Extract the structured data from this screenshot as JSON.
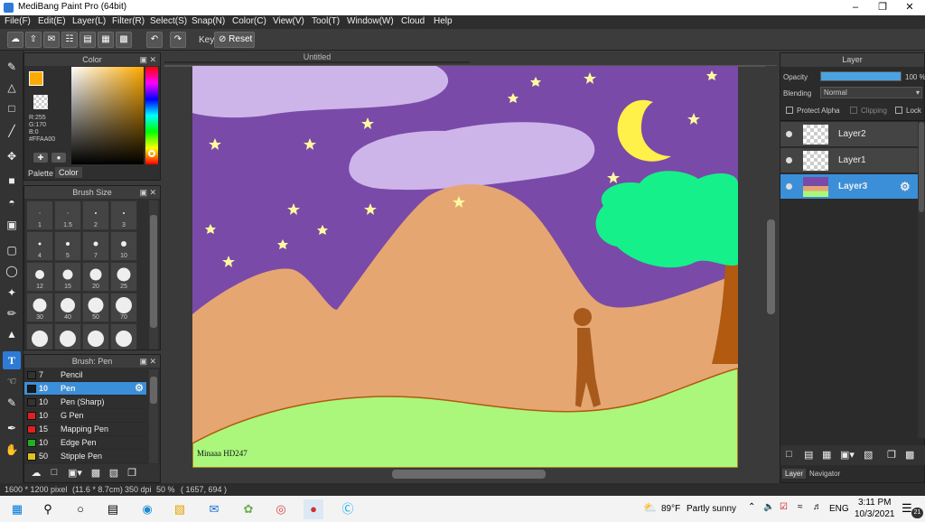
{
  "app": {
    "title": "MediBang Paint Pro (64bit)"
  },
  "menu": [
    "File(F)",
    "Edit(E)",
    "Layer(L)",
    "Filter(R)",
    "Select(S)",
    "Snap(N)",
    "Color(C)",
    "View(V)",
    "Tool(T)",
    "Window(W)",
    "Cloud",
    "Help"
  ],
  "toolbar": {
    "key_label": "Key",
    "reset_label": "Reset"
  },
  "color_panel": {
    "title": "Color",
    "r": "R:255",
    "g": "G:170",
    "b": "B:0",
    "hex": "#FFAA00",
    "tab_palette": "Palette",
    "tab_color": "Color",
    "fg": "#ffaa00"
  },
  "brush_size_panel": {
    "title": "Brush Size",
    "sizes": [
      "1",
      "1.5",
      "2",
      "3",
      "4",
      "5",
      "7",
      "10",
      "12",
      "15",
      "20",
      "25",
      "30",
      "40",
      "50",
      "70",
      "",
      "",
      "",
      ""
    ]
  },
  "brush_panel": {
    "title": "Brush: Pen",
    "brushes": [
      {
        "size": "7",
        "name": "Pencil",
        "color": "#333333"
      },
      {
        "size": "10",
        "name": "Pen",
        "color": "#1a1a1a"
      },
      {
        "size": "10",
        "name": "Pen (Sharp)",
        "color": "#333333"
      },
      {
        "size": "10",
        "name": "G Pen",
        "color": "#e02020"
      },
      {
        "size": "15",
        "name": "Mapping Pen",
        "color": "#e02020"
      },
      {
        "size": "10",
        "name": "Edge Pen",
        "color": "#20b020"
      },
      {
        "size": "50",
        "name": "Stipple Pen",
        "color": "#e0c020"
      }
    ]
  },
  "canvas": {
    "tab_title": "Untitled",
    "signature": "Minaaa HD247"
  },
  "layer_panel": {
    "title": "Layer",
    "opacity_label": "Opacity",
    "opacity_value": "100 %",
    "opacity_fraction": 1.0,
    "blending_label": "Blending",
    "blending_value": "Normal",
    "protect_alpha": "Protect Alpha",
    "clipping": "Clipping",
    "lock": "Lock",
    "layers": [
      {
        "name": "Layer2",
        "selected": false
      },
      {
        "name": "Layer1",
        "selected": false
      },
      {
        "name": "Layer3",
        "selected": true
      }
    ],
    "tab_layer": "Layer",
    "tab_navigator": "Navigator"
  },
  "status": {
    "size": "1600 * 1200 pixel",
    "dims": "(11.6 * 8.7cm)",
    "dpi": "350 dpi",
    "zoom": "50 %",
    "coords": "( 1657, 694 )"
  },
  "taskbar": {
    "weather_temp": "89°F",
    "weather_text": "Partly sunny",
    "lang": "ENG",
    "time": "3:11 PM",
    "date": "10/3/2021",
    "notif_count": "21"
  }
}
